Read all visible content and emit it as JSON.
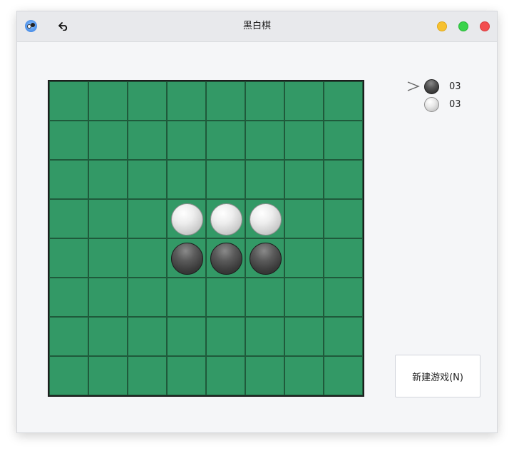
{
  "window": {
    "title": "黑白棋",
    "app_icon": "reversi-app-icon",
    "back_icon": "undo-arrow-icon",
    "controls": [
      "minimize",
      "maximize",
      "close"
    ]
  },
  "board": {
    "size": 8,
    "rows": [
      [
        null,
        null,
        null,
        null,
        null,
        null,
        null,
        null
      ],
      [
        null,
        null,
        null,
        null,
        null,
        null,
        null,
        null
      ],
      [
        null,
        null,
        null,
        null,
        null,
        null,
        null,
        null
      ],
      [
        null,
        null,
        null,
        "white",
        "white",
        "white",
        null,
        null
      ],
      [
        null,
        null,
        null,
        "black",
        "black",
        "black",
        null,
        null
      ],
      [
        null,
        null,
        null,
        null,
        null,
        null,
        null,
        null
      ],
      [
        null,
        null,
        null,
        null,
        null,
        null,
        null,
        null
      ],
      [
        null,
        null,
        null,
        null,
        null,
        null,
        null,
        null
      ]
    ],
    "colors": {
      "cell": "#339966",
      "line": "#1f5a3b",
      "frame": "#1d1f1e"
    }
  },
  "score": {
    "current_turn": "black",
    "black": "03",
    "white": "03"
  },
  "actions": {
    "new_game_label": "新建游戏(N)"
  }
}
